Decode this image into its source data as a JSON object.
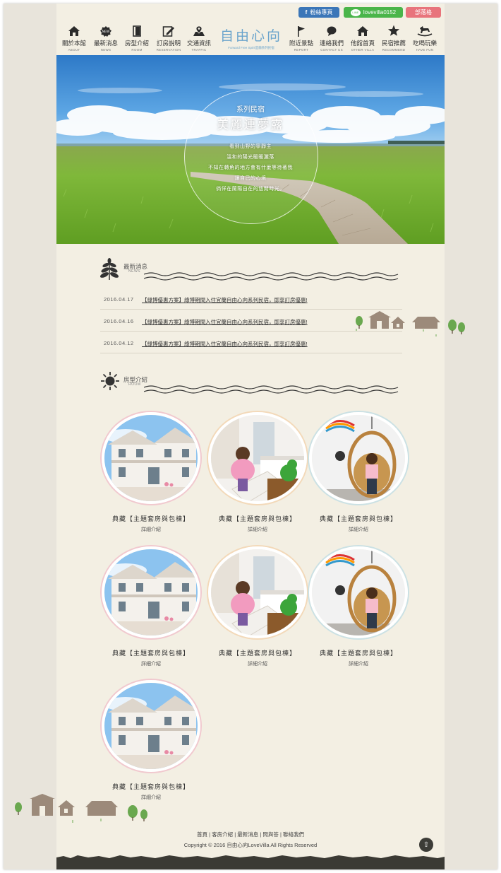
{
  "social": {
    "facebook_label": "粉絲專頁",
    "line_label": "lovevilla0152",
    "blog_label": "部落格"
  },
  "nav": {
    "items": [
      {
        "zh": "關於本館",
        "en": "ABOUT",
        "icon": "house-icon"
      },
      {
        "zh": "最新消息",
        "en": "NEWS",
        "icon": "news-badge-icon"
      },
      {
        "zh": "房型介紹",
        "en": "ROOM",
        "icon": "door-icon"
      },
      {
        "zh": "訂房說明",
        "en": "RESERVATION",
        "icon": "edit-note-icon"
      },
      {
        "zh": "交通資訊",
        "en": "TRAFFIC",
        "icon": "map-pin-icon"
      },
      {
        "zh": "附近景點",
        "en": "REPORT",
        "icon": "flag-icon"
      },
      {
        "zh": "連絡我們",
        "en": "CONTACT US",
        "icon": "chat-bubble-icon"
      },
      {
        "zh": "他館首頁",
        "en": "OTHER VILLA",
        "icon": "house-icon"
      },
      {
        "zh": "民宿推薦",
        "en": "RECOMMEND",
        "icon": "star-icon"
      },
      {
        "zh": "吃喝玩樂",
        "en": "HAVE FUN",
        "icon": "rocking-horse-icon"
      }
    ],
    "logo_text": "自由心向",
    "logo_sub": "Forward Free Spirit宜蘭系列民宿"
  },
  "hero": {
    "subtitle": "系列民宿",
    "title": "美麗連夢露",
    "lines": [
      "看到山野的寧靜主",
      "溫和的陽光暖暖灑落",
      "不知在轉角的地方會有什麼等待著我",
      "讓自己的心境",
      "倘佯在蘭陽自在的悠閒時光。"
    ]
  },
  "news_section": {
    "zh": "最新消息",
    "en": "NEWS",
    "items": [
      {
        "date": "2016.04.17",
        "title": "【綠博優惠方案】綠博期間入住宜蘭自由心向系列民宿，即享訂房優惠!"
      },
      {
        "date": "2016.04.16",
        "title": "【綠博優惠方案】綠博期間入住宜蘭自由心向系列民宿，即享訂房優惠!"
      },
      {
        "date": "2016.04.12",
        "title": "【綠博優惠方案】綠博期間入住宜蘭自由心向系列民宿，即享訂房優惠!"
      }
    ]
  },
  "room_section": {
    "zh": "房型介紹",
    "en": "ROOM",
    "items": [
      {
        "name": "典藏【主題套房與包棟】",
        "more": "詳細介紹",
        "photo": "villa",
        "ring": "#f1c9cf"
      },
      {
        "name": "典藏【主題套房與包棟】",
        "more": "詳細介紹",
        "photo": "slide",
        "ring": "#f3d9b9"
      },
      {
        "name": "典藏【主題套房與包棟】",
        "more": "詳細介紹",
        "photo": "swing",
        "ring": "#cbe1e4"
      },
      {
        "name": "典藏【主題套房與包棟】",
        "more": "詳細介紹",
        "photo": "villa",
        "ring": "#f1c9cf"
      },
      {
        "name": "典藏【主題套房與包棟】",
        "more": "詳細介紹",
        "photo": "slide",
        "ring": "#f3d9b9"
      },
      {
        "name": "典藏【主題套房與包棟】",
        "more": "詳細介紹",
        "photo": "swing",
        "ring": "#cbe1e4"
      },
      {
        "name": "典藏【主題套房與包棟】",
        "more": "詳細介紹",
        "photo": "villa",
        "ring": "#f1c9cf"
      }
    ]
  },
  "footer": {
    "links": "首頁 | 客房介紹 | 最新消息 | 問與答 | 聯絡我們",
    "copyright": "Copyright © 2016 自由心向LoveVilla All Rights Reserved",
    "to_top_icon": "arrow-up-icon"
  },
  "colors": {
    "page_bg": "#f3efe3",
    "frame_bg": "#e8e4db",
    "facebook": "#3b76b8",
    "line": "#4ab54a",
    "blog": "#e8747c",
    "logo_blue": "#6aa4cc"
  }
}
